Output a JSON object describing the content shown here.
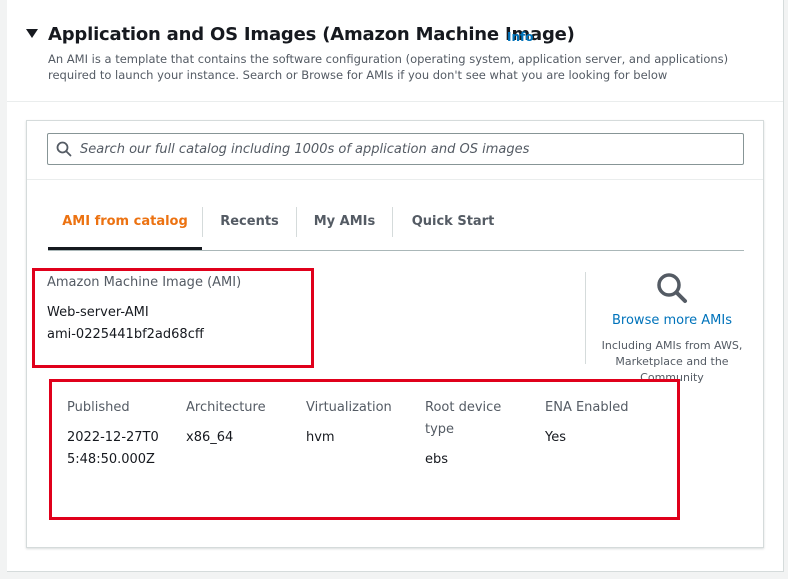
{
  "header": {
    "title": "Application and OS Images (Amazon Machine Image)",
    "info_label": "Info",
    "description": "An AMI is a template that contains the software configuration (operating system, application server, and applications) required to launch your instance. Search or Browse for AMIs if you don't see what you are looking for below"
  },
  "search": {
    "placeholder": "Search our full catalog including 1000s of application and OS images",
    "value": ""
  },
  "tabs": [
    {
      "label": "AMI from catalog",
      "active": true
    },
    {
      "label": "Recents",
      "active": false
    },
    {
      "label": "My AMIs",
      "active": false
    },
    {
      "label": "Quick Start",
      "active": false
    }
  ],
  "ami": {
    "label": "Amazon Machine Image (AMI)",
    "name": "Web-server-AMI",
    "id": "ami-0225441bf2ad68cff"
  },
  "browse": {
    "icon": "search-icon",
    "link": "Browse more AMIs",
    "subtext": "Including AMIs from AWS, Marketplace and the Community"
  },
  "details": [
    {
      "key": "Published",
      "value": "2022-12-27T05:48:50.000Z"
    },
    {
      "key": "Architecture",
      "value": "x86_64"
    },
    {
      "key": "Virtualization",
      "value": "hvm"
    },
    {
      "key": "Root device type",
      "value": "ebs"
    },
    {
      "key": "ENA Enabled",
      "value": "Yes"
    }
  ],
  "colors": {
    "accent_orange": "#ec7211",
    "link_blue": "#0073bb",
    "highlight_red": "#e0001b"
  }
}
